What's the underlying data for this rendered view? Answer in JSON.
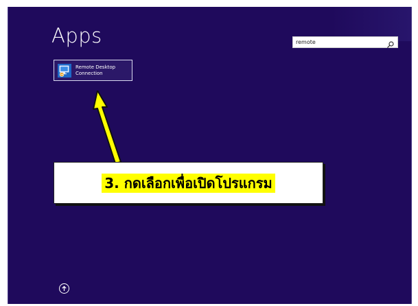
{
  "screen": {
    "title": "Apps",
    "background_color": "#1f0a5c",
    "accent_color": "#1f69c7"
  },
  "search": {
    "value": "remote",
    "icon": "search-icon"
  },
  "results": [
    {
      "label": "Remote Desktop Connection",
      "icon": "remote-desktop-icon"
    }
  ],
  "annotation": {
    "text": "3. กดเลือกเพื่อเปิดโปรแกรม",
    "highlight_color": "#ffff00",
    "arrow_color": "#ffff00"
  },
  "navigation": {
    "up_icon": "arrow-up-icon"
  }
}
